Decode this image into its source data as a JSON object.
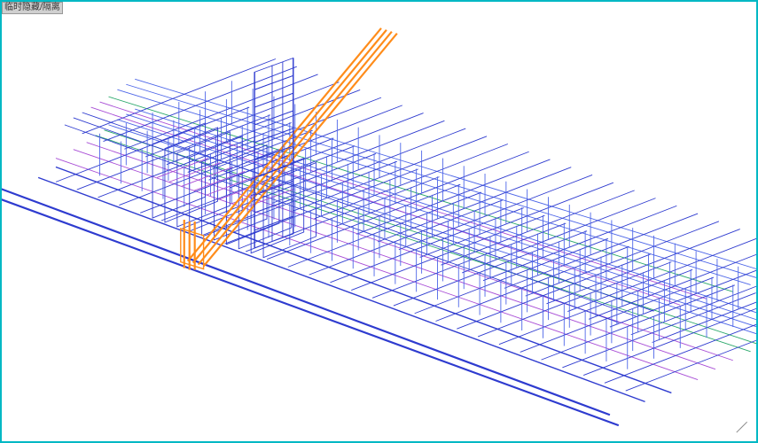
{
  "header": {
    "tag_label": "临时隐藏/隔离"
  },
  "diagram": {
    "description": "reinforcement-cage-3d-isometric",
    "colors": {
      "primary_rebar": "#2e3bcf",
      "stirrup": "#4d66e8",
      "tie_purple": "#a84dd6",
      "tie_green": "#2aa86b",
      "column_bar": "#ff8c1a"
    }
  }
}
